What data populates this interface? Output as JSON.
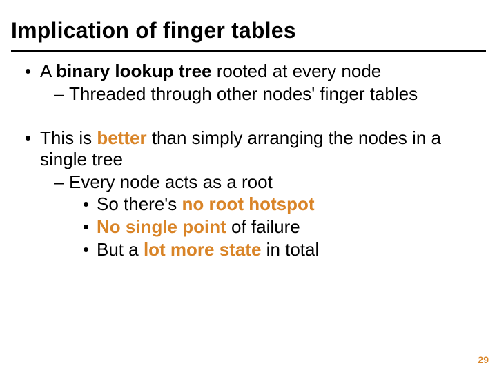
{
  "title": "Implication of finger tables",
  "bullets": {
    "b1": {
      "pre": "A ",
      "bold": "binary lookup tree",
      "post": " rooted at every node"
    },
    "b1_1": "Threaded through other nodes' finger tables",
    "b2": {
      "pre": "This is ",
      "hl": "better",
      "post": " than simply arranging the nodes in a single tree"
    },
    "b2_1": "Every node acts as a root",
    "b2_1_1": {
      "pre": "So there's ",
      "hl": "no root hotspot"
    },
    "b2_1_2": {
      "hl": "No single point",
      "post": " of failure"
    },
    "b2_1_3": {
      "pre": "But a ",
      "hl": "lot more state",
      "post": " in total"
    }
  },
  "markers": {
    "dot": "•",
    "dash": "–"
  },
  "pagenum": "29"
}
